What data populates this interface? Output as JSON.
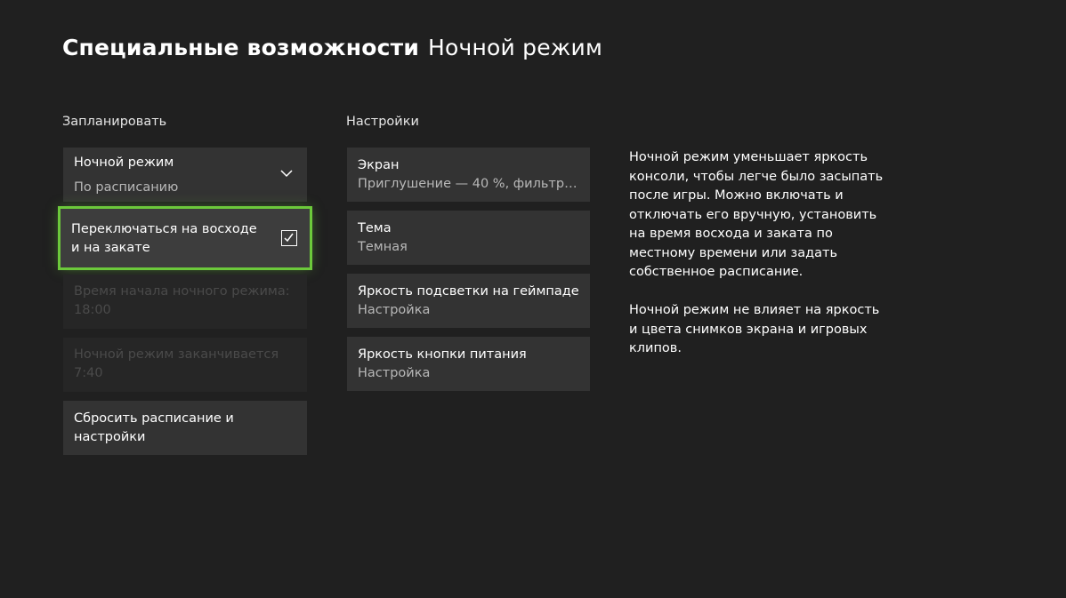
{
  "header": {
    "section": "Специальные возможности",
    "subsection": "Ночной режим"
  },
  "schedule": {
    "label": "Запланировать",
    "night_mode": {
      "title": "Ночной режим",
      "value": "По расписанию"
    },
    "sun_toggle": {
      "label": "Переключаться на восходе и на закате",
      "checked": true
    },
    "start_time": {
      "title": "Время начала ночного режима:",
      "value": "18:00"
    },
    "end_time": {
      "title": "Ночной режим заканчивается",
      "value": "7:40"
    },
    "reset": {
      "label": "Сбросить расписание и настройки"
    }
  },
  "settings": {
    "label": "Настройки",
    "items": [
      {
        "title": "Экран",
        "value": "Приглушение — 40 %, фильтра..."
      },
      {
        "title": "Тема",
        "value": "Темная"
      },
      {
        "title": "Яркость подсветки на геймпаде",
        "value": "Настройка"
      },
      {
        "title": "Яркость кнопки питания",
        "value": "Настройка"
      }
    ]
  },
  "description": {
    "paragraph1": "Ночной режим уменьшает яркость консоли, чтобы легче было засыпать после игры. Можно включать и отключать его вручную, установить на время восхода и заката по местному времени или задать собственное расписание.",
    "paragraph2": "Ночной режим не влияет на яркость и цвета снимков экрана и игровых клипов."
  },
  "colors": {
    "background": "#202020",
    "tile": "#333333",
    "focus_accent": "#6cc93b"
  }
}
